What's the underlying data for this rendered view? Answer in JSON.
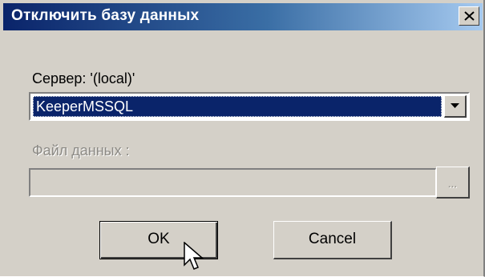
{
  "window": {
    "title": "Отключить базу данных",
    "close_icon": "close-icon"
  },
  "server": {
    "label": "Сервер: '(local)'",
    "selected_database": "KeeperMSSQL",
    "dropdown_icon": "chevron-down-icon"
  },
  "data_file": {
    "label": "Файл данных :",
    "value": "",
    "browse_label": "..."
  },
  "buttons": {
    "ok_label": "OK",
    "cancel_label": "Cancel"
  },
  "colors": {
    "title_gradient_start": "#0a246a",
    "title_gradient_end": "#a6caf0",
    "dialog_face": "#d4d0c8",
    "selection": "#0a246a",
    "disabled_text": "#8c8a85"
  }
}
